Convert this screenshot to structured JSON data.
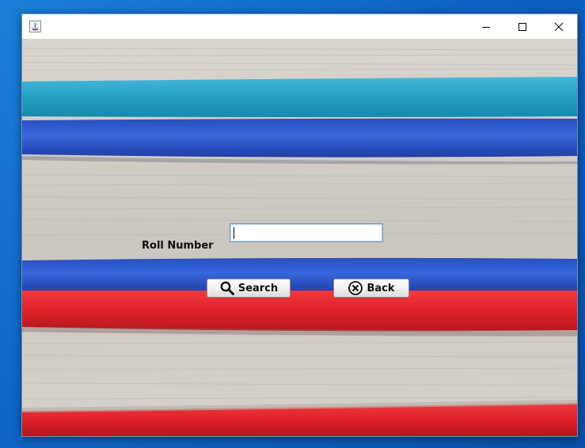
{
  "window": {
    "title": "",
    "controls": {
      "minimize": "minimize-icon",
      "maximize": "maximize-icon",
      "close": "close-icon"
    }
  },
  "form": {
    "roll_number_label": "Roll Number",
    "roll_number_value": "",
    "roll_number_placeholder": ""
  },
  "buttons": {
    "search_label": "Search",
    "back_label": "Back"
  },
  "colors": {
    "desktop": "#1372d0",
    "teal_book": "#2aa6c9",
    "blue_book": "#2f5fd0",
    "red_book": "#e0262e",
    "page_edge": "#d4d0c9"
  }
}
